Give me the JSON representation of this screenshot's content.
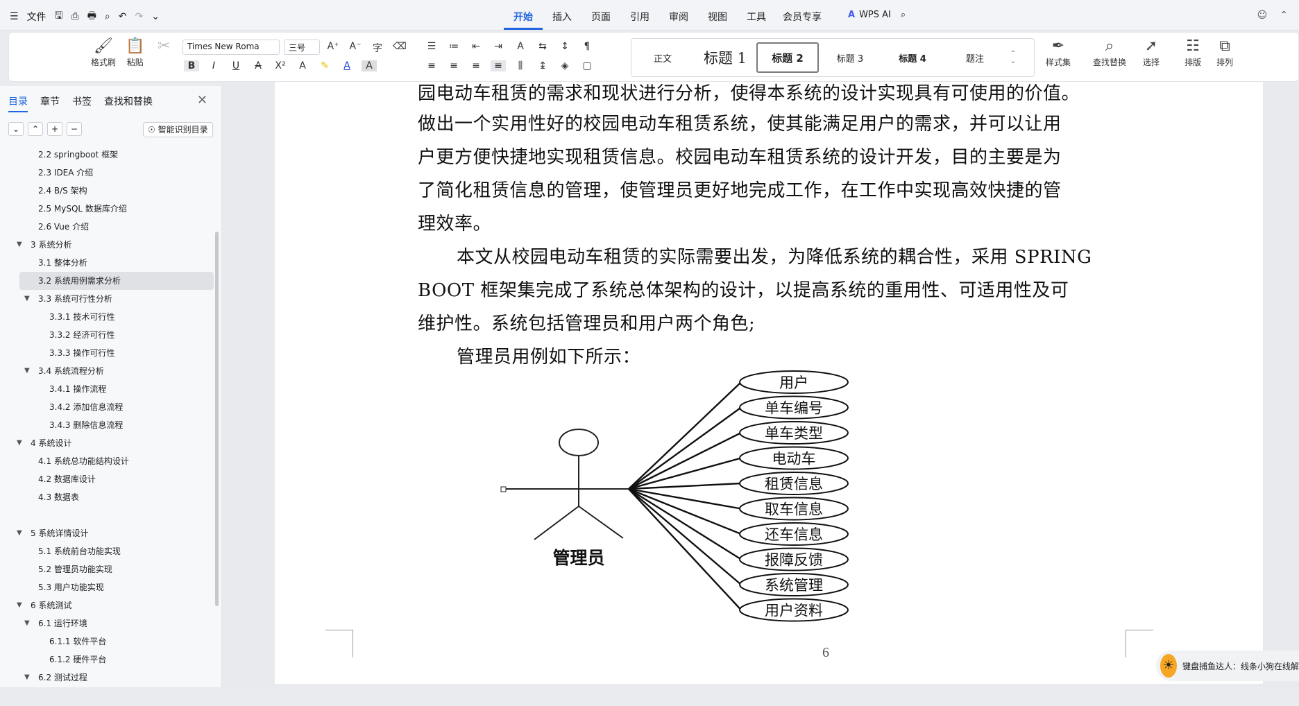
{
  "menubar": {
    "file_label": "文件",
    "tabs": [
      "开始",
      "插入",
      "页面",
      "引用",
      "审阅",
      "视图",
      "工具",
      "会员专享"
    ],
    "active_tab": "开始",
    "wps_ai_label": "WPS AI"
  },
  "ribbon": {
    "format_brush": "格式刷",
    "paste": "粘贴",
    "font_name": "Times New Roma",
    "font_size": "三号",
    "styles": [
      {
        "label": "正文",
        "kind": "normal"
      },
      {
        "label": "标题 1",
        "kind": "big"
      },
      {
        "label": "标题 2",
        "kind": "sel"
      },
      {
        "label": "标题 3",
        "kind": "normal"
      },
      {
        "label": "标题 4",
        "kind": "bold"
      },
      {
        "label": "题注",
        "kind": "normal"
      }
    ],
    "style_set": "样式集",
    "find_replace": "查找替换",
    "select": "选择",
    "layout": "排版",
    "arrange": "排列"
  },
  "sidebar": {
    "tabs": [
      "目录",
      "章节",
      "书签",
      "查找和替换"
    ],
    "smart_button": "智能识别目录",
    "toc": [
      {
        "label": "2.2 springboot 框架",
        "level": 2,
        "arrow": false,
        "selected": false
      },
      {
        "label": "2.3 IDEA 介绍",
        "level": 2,
        "arrow": false,
        "selected": false
      },
      {
        "label": "2.4 B/S 架构",
        "level": 2,
        "arrow": false,
        "selected": false
      },
      {
        "label": "2.5 MySQL 数据库介绍",
        "level": 2,
        "arrow": false,
        "selected": false
      },
      {
        "label": "2.6 Vue 介绍",
        "level": 2,
        "arrow": false,
        "selected": false
      },
      {
        "label": "3  系统分析",
        "level": 1,
        "arrow": true,
        "selected": false
      },
      {
        "label": "3.1 整体分析",
        "level": 2,
        "arrow": false,
        "selected": false
      },
      {
        "label": "3.2 系统用例需求分析",
        "level": 2,
        "arrow": false,
        "selected": true
      },
      {
        "label": "3.3 系统可行性分析",
        "level": 2,
        "arrow": true,
        "selected": false
      },
      {
        "label": "3.3.1 技术可行性",
        "level": 3,
        "arrow": false,
        "selected": false
      },
      {
        "label": "3.3.2 经济可行性",
        "level": 3,
        "arrow": false,
        "selected": false
      },
      {
        "label": "3.3.3 操作可行性",
        "level": 3,
        "arrow": false,
        "selected": false
      },
      {
        "label": "3.4 系统流程分析",
        "level": 2,
        "arrow": true,
        "selected": false
      },
      {
        "label": "3.4.1 操作流程",
        "level": 3,
        "arrow": false,
        "selected": false
      },
      {
        "label": "3.4.2 添加信息流程",
        "level": 3,
        "arrow": false,
        "selected": false
      },
      {
        "label": "3.4.3 删除信息流程",
        "level": 3,
        "arrow": false,
        "selected": false
      },
      {
        "label": "4  系统设计",
        "level": 1,
        "arrow": true,
        "selected": false
      },
      {
        "label": "4.1 系统总功能结构设计",
        "level": 2,
        "arrow": false,
        "selected": false
      },
      {
        "label": "4.2 数据库设计",
        "level": 2,
        "arrow": false,
        "selected": false
      },
      {
        "label": "4.3 数据表",
        "level": 2,
        "arrow": false,
        "selected": false
      },
      {
        "label": "",
        "level": 2,
        "arrow": false,
        "selected": false
      },
      {
        "label": "5  系统详情设计",
        "level": 1,
        "arrow": true,
        "selected": false
      },
      {
        "label": "5.1 系统前台功能实现",
        "level": 2,
        "arrow": false,
        "selected": false
      },
      {
        "label": "5.2 管理员功能实现",
        "level": 2,
        "arrow": false,
        "selected": false
      },
      {
        "label": "5.3 用户功能实现",
        "level": 2,
        "arrow": false,
        "selected": false
      },
      {
        "label": "6   系统测试",
        "level": 1,
        "arrow": true,
        "selected": false
      },
      {
        "label": "6.1 运行环境",
        "level": 2,
        "arrow": true,
        "selected": false
      },
      {
        "label": "6.1.1 软件平台",
        "level": 3,
        "arrow": false,
        "selected": false
      },
      {
        "label": "6.1.2 硬件平台",
        "level": 3,
        "arrow": false,
        "selected": false
      },
      {
        "label": "6.2 测试过程",
        "level": 2,
        "arrow": true,
        "selected": false
      }
    ]
  },
  "document": {
    "lines": [
      "园电动车租赁的需求和现状进行分析，使得本系统的设计实现具有可使用的价值。",
      "做出一个实用性好的校园电动车租赁系统，使其能满足用户的需求，并可以让用",
      "户更方便快捷地实现租赁信息。校园电动车租赁系统的设计开发，目的主要是为",
      "了简化租赁信息的管理，使管理员更好地完成工作，在工作中实现高效快捷的管",
      "理效率。",
      "本文从校园电动车租赁的实际需要出发，为降低系统的耦合性，采用 SPRING",
      "BOOT 框架集完成了系统总体架构的设计，以提高系统的重用性、可适用性及可",
      "维护性。系统包括管理员和用户两个角色;",
      "管理员用例如下所示："
    ],
    "diagram": {
      "actor": "管理员",
      "use_cases": [
        "用户",
        "单车编号",
        "单车类型",
        "电动车",
        "租赁信息",
        "取车信息",
        "还车信息",
        "报障反馈",
        "系统管理",
        "用户资料"
      ]
    },
    "page_number": "6"
  },
  "notification": {
    "text": "键盘捕鱼达人：线条小狗在线解"
  }
}
